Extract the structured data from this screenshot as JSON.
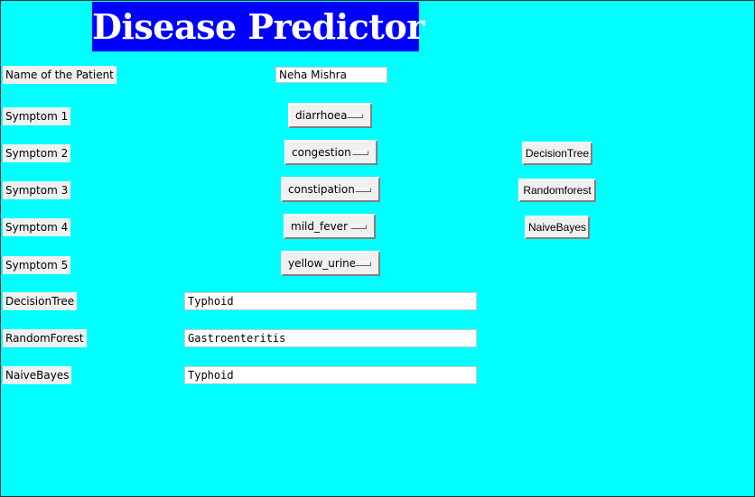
{
  "app": {
    "title": "Disease Predictor"
  },
  "patient": {
    "label": "Name of the Patient",
    "value": "Neha Mishra"
  },
  "symptoms": [
    {
      "label": "Symptom 1",
      "value": "diarrhoea"
    },
    {
      "label": "Symptom 2",
      "value": "congestion"
    },
    {
      "label": "Symptom 3",
      "value": "constipation"
    },
    {
      "label": "Symptom 4",
      "value": "mild_fever"
    },
    {
      "label": "Symptom 5",
      "value": "yellow_urine"
    }
  ],
  "buttons": {
    "decision_tree": "DecisionTree",
    "random_forest": "Randomforest",
    "naive_bayes": "NaiveBayes"
  },
  "results": [
    {
      "label": "DecisionTree",
      "value": "Typhoid"
    },
    {
      "label": "RandomForest",
      "value": "Gastroenteritis"
    },
    {
      "label": "NaiveBayes",
      "value": "Typhoid"
    }
  ],
  "colors": {
    "background": "#00ffff",
    "title_bg": "#0000ff",
    "title_fg": "#ffffff"
  }
}
